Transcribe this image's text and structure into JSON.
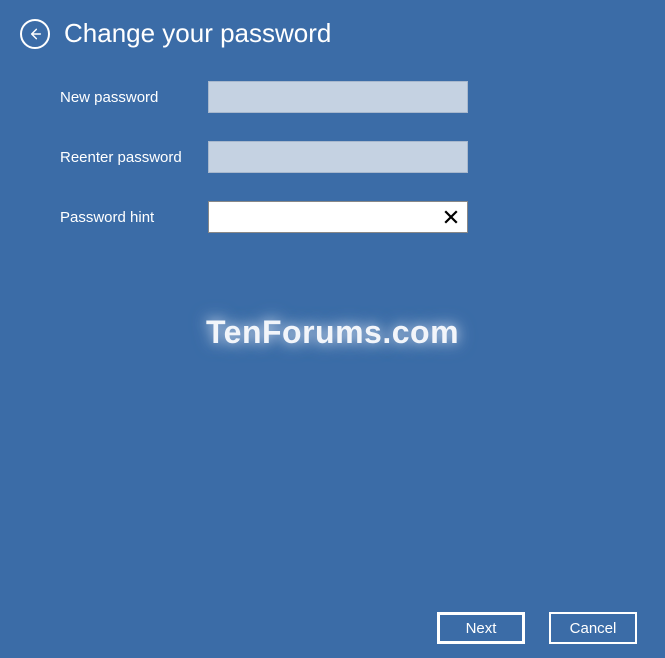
{
  "header": {
    "title": "Change your password"
  },
  "form": {
    "newPassword": {
      "label": "New password",
      "value": ""
    },
    "reenterPassword": {
      "label": "Reenter password",
      "value": ""
    },
    "passwordHint": {
      "label": "Password hint",
      "value": ""
    }
  },
  "watermark": "TenForums.com",
  "buttons": {
    "next": "Next",
    "cancel": "Cancel"
  }
}
